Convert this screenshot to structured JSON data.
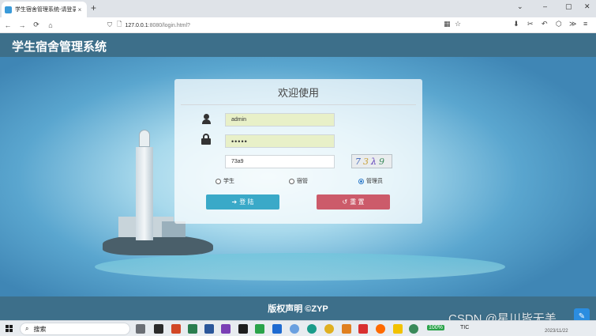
{
  "browser": {
    "tab_title": "学生宿舍管理系统-请登录",
    "tab_close": "×",
    "new_tab": "+",
    "url_host": "127.0.0.1",
    "url_rest": ":8080/login.html?",
    "window_controls": [
      "⌄",
      "–",
      "▢",
      "✕"
    ],
    "nav": [
      "←",
      "→",
      "⟳",
      "⌂"
    ],
    "toolbar_right": [
      "⬇",
      "✂",
      "↶",
      "⬡",
      "≫",
      "≡"
    ]
  },
  "site": {
    "title": "学生宿舍管理系统",
    "footer": "版权声明 ©ZYP"
  },
  "login": {
    "heading": "欢迎使用",
    "username_value": "admin",
    "password_value": "•••••",
    "captcha_input_value": "73a9",
    "captcha_image_chars": [
      "7",
      "3",
      "λ",
      "9"
    ],
    "roles": [
      {
        "label": "学生",
        "checked": false
      },
      {
        "label": "宿管",
        "checked": false
      },
      {
        "label": "管理员",
        "checked": true
      }
    ],
    "login_button": "登 陆",
    "login_icon": "➔",
    "reset_button": "重 置",
    "reset_icon": "↺"
  },
  "taskbar": {
    "search_label": "搜索",
    "search_glyph": "⌕",
    "tray_text_1": "TIC",
    "tray_badge": "100%",
    "date": "2023/11/22"
  },
  "watermark": "CSDN @星川皆无恙",
  "notification_glyph": "✎"
}
